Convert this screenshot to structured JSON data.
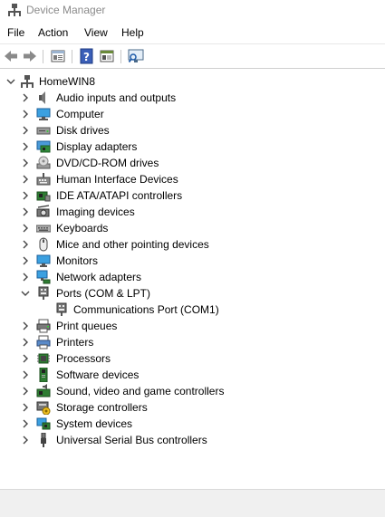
{
  "window": {
    "title": "Device Manager"
  },
  "menu": [
    "File",
    "Action",
    "View",
    "Help"
  ],
  "toolbar": {
    "buttons": [
      "back-icon",
      "forward-icon",
      "properties-icon",
      "help-icon",
      "show-hidden-icon",
      "scan-hardware-icon"
    ]
  },
  "tree": {
    "root": "HomeWIN8",
    "categories": [
      {
        "label": "Audio inputs and outputs",
        "icon": "speaker-icon",
        "expanded": false
      },
      {
        "label": "Computer",
        "icon": "computer-icon",
        "expanded": false
      },
      {
        "label": "Disk drives",
        "icon": "disk-drive-icon",
        "expanded": false
      },
      {
        "label": "Display adapters",
        "icon": "display-adapter-icon",
        "expanded": false
      },
      {
        "label": "DVD/CD-ROM drives",
        "icon": "dvd-drive-icon",
        "expanded": false
      },
      {
        "label": "Human Interface Devices",
        "icon": "hid-icon",
        "expanded": false
      },
      {
        "label": "IDE ATA/ATAPI controllers",
        "icon": "ide-controller-icon",
        "expanded": false
      },
      {
        "label": "Imaging devices",
        "icon": "camera-icon",
        "expanded": false
      },
      {
        "label": "Keyboards",
        "icon": "keyboard-icon",
        "expanded": false
      },
      {
        "label": "Mice and other pointing devices",
        "icon": "mouse-icon",
        "expanded": false
      },
      {
        "label": "Monitors",
        "icon": "monitor-icon",
        "expanded": false
      },
      {
        "label": "Network adapters",
        "icon": "network-adapter-icon",
        "expanded": false
      },
      {
        "label": "Ports (COM & LPT)",
        "icon": "port-icon",
        "expanded": true,
        "children": [
          {
            "label": "Communications Port (COM1)",
            "icon": "port-icon"
          }
        ]
      },
      {
        "label": "Print queues",
        "icon": "print-queue-icon",
        "expanded": false
      },
      {
        "label": "Printers",
        "icon": "printer-icon",
        "expanded": false
      },
      {
        "label": "Processors",
        "icon": "processor-icon",
        "expanded": false
      },
      {
        "label": "Software devices",
        "icon": "software-device-icon",
        "expanded": false
      },
      {
        "label": "Sound, video and game controllers",
        "icon": "sound-controller-icon",
        "expanded": false
      },
      {
        "label": "Storage controllers",
        "icon": "storage-controller-icon",
        "expanded": false
      },
      {
        "label": "System devices",
        "icon": "system-device-icon",
        "expanded": false
      },
      {
        "label": "Universal Serial Bus controllers",
        "icon": "usb-icon",
        "expanded": false
      }
    ]
  }
}
